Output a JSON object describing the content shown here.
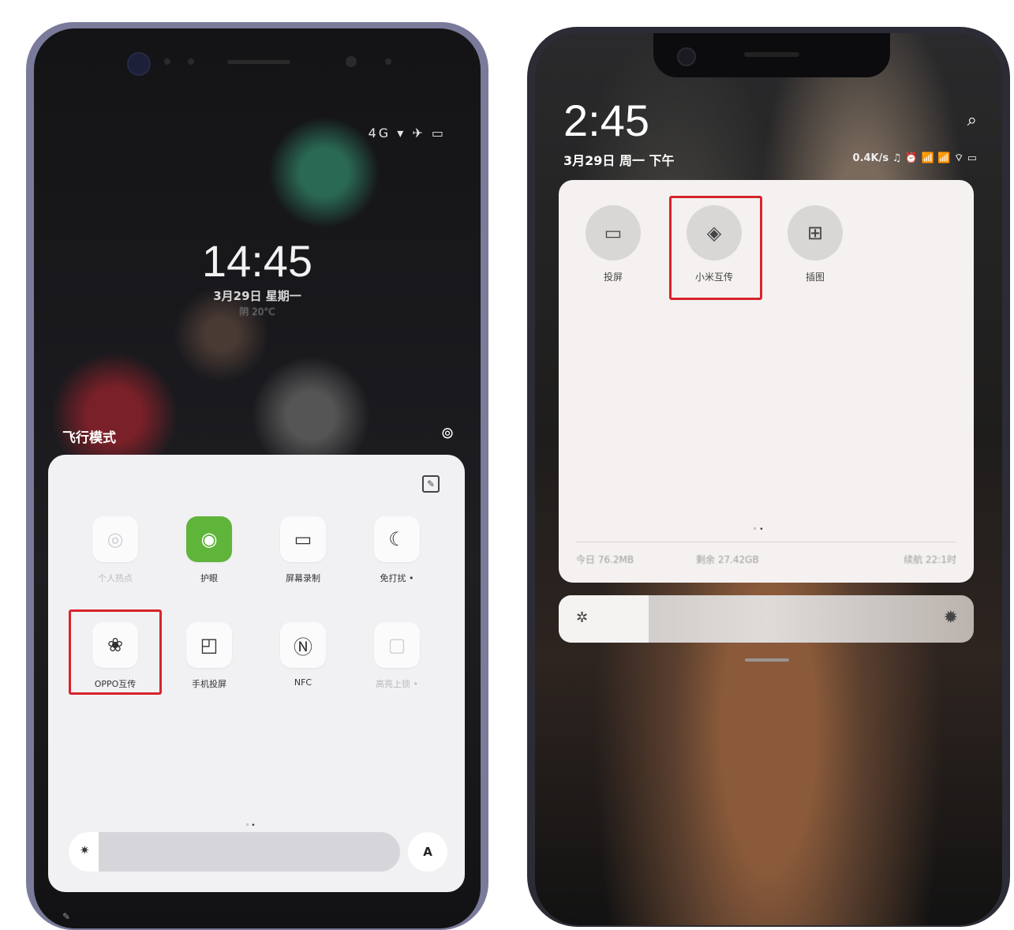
{
  "left_phone": {
    "status_icons": "4G ▾ ✈ ▭",
    "clock": "14:45",
    "date": "3月29日 星期一",
    "weather": "阴 20°C",
    "airplane_mode_label": "飞行模式",
    "quick_tiles": [
      {
        "label": "个人热点",
        "icon": "hotspot-icon",
        "state": "off"
      },
      {
        "label": "护眼",
        "icon": "eye-comfort-icon",
        "state": "on"
      },
      {
        "label": "屏幕录制",
        "icon": "screen-record-icon",
        "state": "normal"
      },
      {
        "label": "免打扰 •",
        "icon": "moon-icon",
        "state": "normal"
      },
      {
        "label": "OPPO互传",
        "icon": "oppo-share-icon",
        "state": "highlighted"
      },
      {
        "label": "手机投屏",
        "icon": "screen-cast-icon",
        "state": "normal"
      },
      {
        "label": "NFC",
        "icon": "nfc-icon",
        "state": "normal"
      },
      {
        "label": "高亮上锁 •",
        "icon": "lock-screen-icon",
        "state": "off"
      }
    ],
    "page_indicator": "◦•",
    "brightness_auto_label": "A",
    "highlight_color": "#d8232a"
  },
  "right_phone": {
    "clock": "2:45",
    "date": "3月29日 周一 下午",
    "status_bar": "0.4K/s ♫ ⏰ 📶 📶 ⌔ ▭",
    "quick_tiles": [
      {
        "label": "投屏",
        "icon": "cast-screen-icon"
      },
      {
        "label": "小米互传",
        "icon": "mi-share-icon",
        "state": "highlighted"
      },
      {
        "label": "插图",
        "icon": "grid-icon"
      }
    ],
    "page_indicator": "◦•",
    "data_usage": {
      "today": "今日 76.2MB",
      "remaining": "剩余 27.42GB",
      "battery": "续航 22:1时"
    }
  }
}
